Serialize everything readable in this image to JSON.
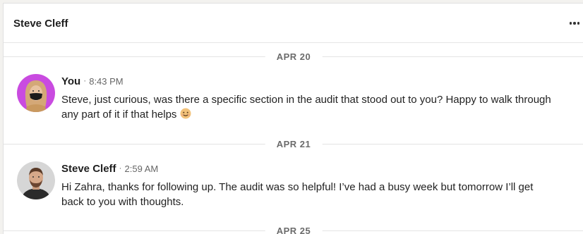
{
  "conversation": {
    "title": "Steve Cleff"
  },
  "dates": [
    {
      "label": "APR 20"
    },
    {
      "label": "APR 21"
    },
    {
      "label": "APR 25"
    }
  ],
  "messages": [
    {
      "sender": "You",
      "separator": "·",
      "time": "8:43 PM",
      "text": "Steve, just curious, was there a specific section in the audit that stood out to you? Happy to walk through any part of it if that helps",
      "emoji": "smiling-face-emoji"
    },
    {
      "sender": "Steve Cleff",
      "separator": "·",
      "time": "2:59 AM",
      "text": "Hi Zahra, thanks for following up. The audit was so helpful! I’ve had a busy week but tomorrow I’ll get back to you with thoughts."
    }
  ],
  "colors": {
    "you_avatar_bg": "#c94be0",
    "steve_avatar_bg": "#7a7a7a"
  }
}
